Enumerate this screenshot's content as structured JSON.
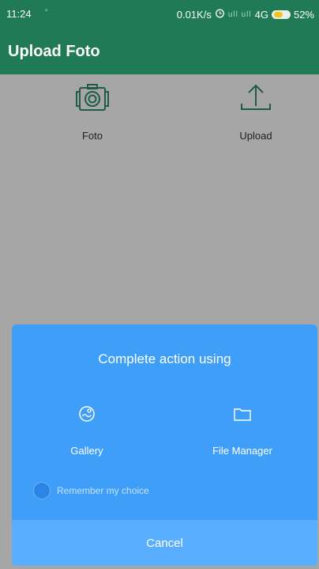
{
  "status_bar": {
    "time": "11:24",
    "indicator": "▫",
    "network_speed": "0.01K/s",
    "alarm_icon": "alarm-icon",
    "signal_text": "ull ull",
    "network_type": "4G",
    "battery": "52%"
  },
  "app_bar": {
    "title": "Upload Foto",
    "color": "#1f7a55"
  },
  "actions": [
    {
      "label": "Foto",
      "icon": "camera-icon"
    },
    {
      "label": "Upload",
      "icon": "upload-icon"
    }
  ],
  "dialog": {
    "title": "Complete action using",
    "options": [
      {
        "label": "Gallery",
        "icon": "gallery-icon"
      },
      {
        "label": "File Manager",
        "icon": "folder-icon"
      }
    ],
    "remember_label": "Remember my choice",
    "cancel_label": "Cancel",
    "color": "#3f9ff8"
  }
}
